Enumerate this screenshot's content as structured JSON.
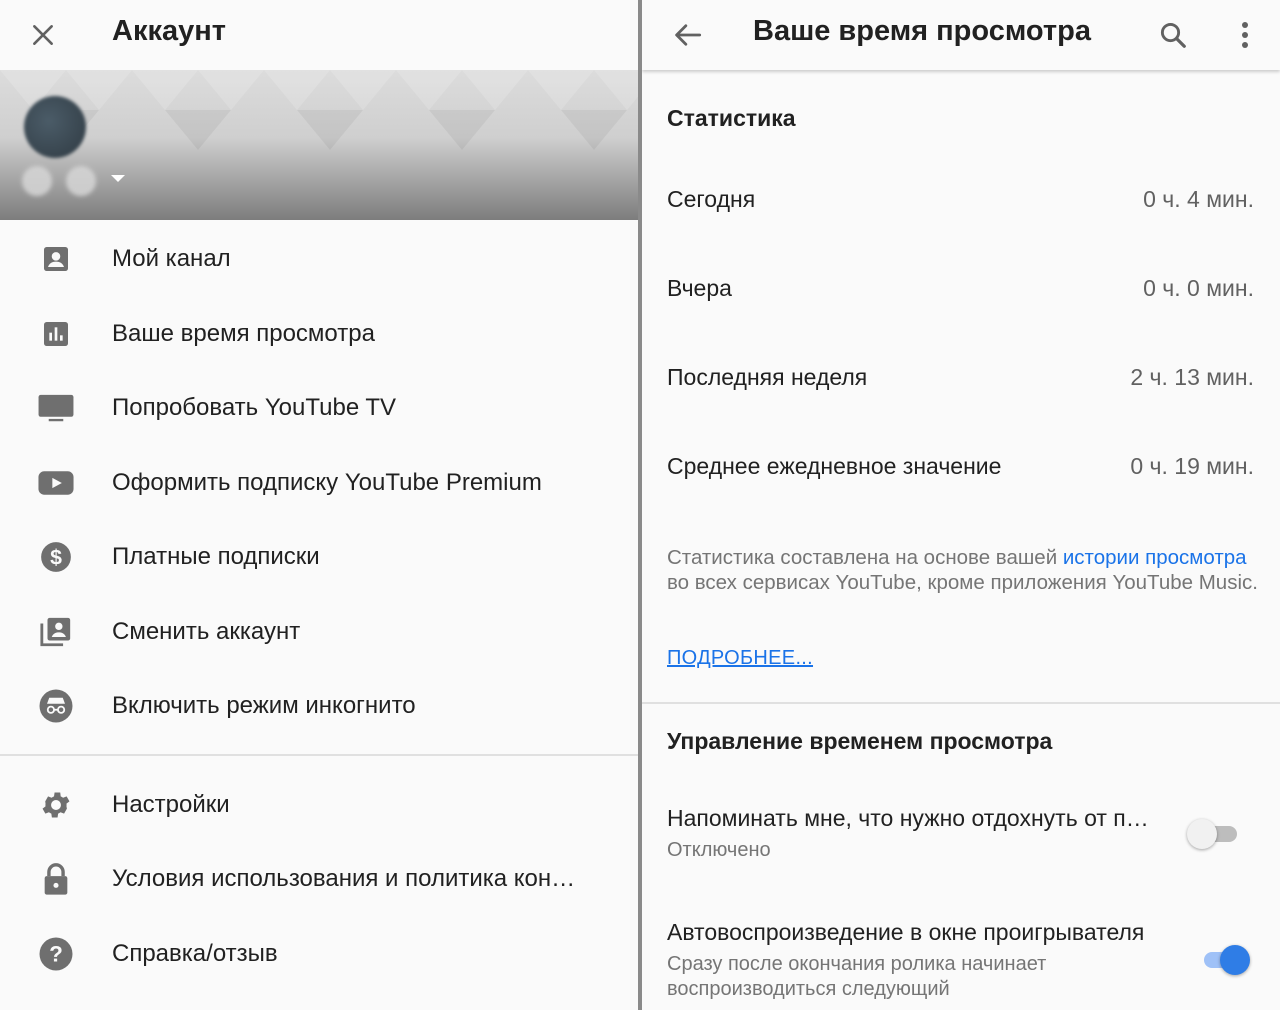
{
  "left": {
    "header": {
      "title": "Аккаунт",
      "close_icon": "close-icon"
    },
    "menu_primary": [
      {
        "label": "Мой канал",
        "icon": "account-box-icon"
      },
      {
        "label": "Ваше время просмотра",
        "icon": "bar-chart-icon"
      },
      {
        "label": "Попробовать YouTube TV",
        "icon": "tv-icon"
      },
      {
        "label": "Оформить подписку YouTube Premium",
        "icon": "youtube-play-icon"
      },
      {
        "label": "Платные подписки",
        "icon": "dollar-circle-icon"
      },
      {
        "label": "Сменить аккаунт",
        "icon": "switch-account-icon"
      },
      {
        "label": "Включить режим инкогнито",
        "icon": "incognito-icon"
      }
    ],
    "menu_secondary": [
      {
        "label": "Настройки",
        "icon": "gear-icon"
      },
      {
        "label": "Условия использования и политика конфиденциальности",
        "icon": "lock-icon"
      },
      {
        "label": "Справка/отзыв",
        "icon": "help-icon"
      }
    ]
  },
  "right": {
    "header": {
      "title": "Ваше время просмотра",
      "back_icon": "arrow-back-icon",
      "search_icon": "search-icon",
      "more_icon": "more-vert-icon"
    },
    "stats": {
      "title": "Статистика",
      "rows": [
        {
          "label": "Сегодня",
          "value": "0 ч. 4 мин."
        },
        {
          "label": "Вчера",
          "value": "0 ч. 0 мин."
        },
        {
          "label": "Последняя неделя",
          "value": "2 ч. 13 мин."
        },
        {
          "label": "Среднее ежедневное значение",
          "value": "0 ч. 19 мин."
        }
      ],
      "note_before": "Статистика составлена на основе вашей ",
      "note_link": "истории просмотра",
      "note_after": " во всех сервисах YouTube, кроме приложения YouTube Music.",
      "more_link": "ПОДРОБНЕЕ..."
    },
    "manage": {
      "title": "Управление временем просмотра",
      "settings": [
        {
          "title": "Напоминать мне, что нужно отдохнуть от просмотра",
          "subtitle": "Отключено",
          "enabled": false
        },
        {
          "title": "Автовоспроизведение в окне проигрывателя",
          "subtitle": "Сразу после окончания ролика начинает воспроизводиться следующий",
          "enabled": true
        }
      ]
    }
  },
  "colors": {
    "accent": "#1a73e8",
    "toggle_on": "#2f7de6",
    "icon_grey": "#757575"
  }
}
